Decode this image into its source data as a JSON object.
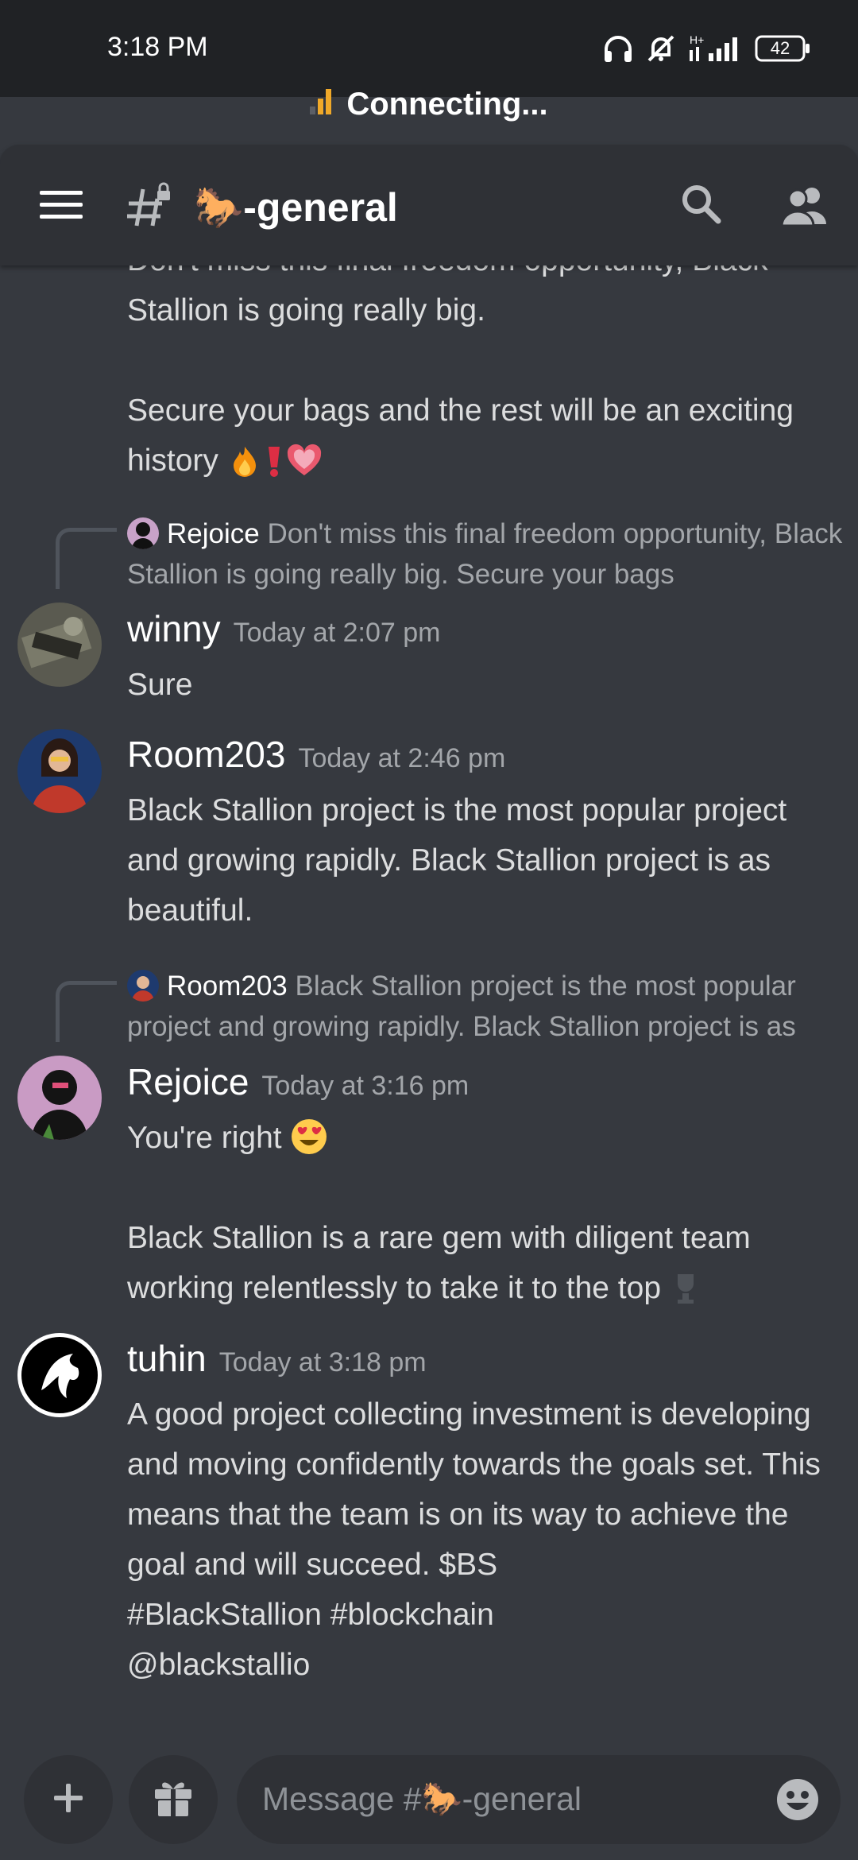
{
  "status_bar": {
    "time": "3:18 PM",
    "network": "H+",
    "battery": "42",
    "connection_status": "Connecting..."
  },
  "header": {
    "channel_name": "🐎-general"
  },
  "messages": {
    "partial_text_line1": "Don't miss this final freedom opportunity, Black",
    "partial_text_line2": "Stallion is going really big.",
    "partial_text_line3": "Secure your bags and the rest will be an exciting",
    "partial_text_line4": "history",
    "reply1": {
      "author": "Rejoice",
      "excerpt": "Don't miss this final freedom opportunity, Black Stallion is going really big.    Secure your bags"
    },
    "winny": {
      "username": "winny",
      "timestamp": "Today at 2:07 pm",
      "text": "Sure"
    },
    "room203": {
      "username": "Room203",
      "timestamp": "Today at 2:46 pm",
      "text": "Black Stallion project is the most popular project and growing rapidly. Black Stallion project is as beautiful."
    },
    "reply2": {
      "author": "Room203",
      "excerpt": "Black Stallion project is the most popular project and growing rapidly. Black Stallion project is as"
    },
    "rejoice": {
      "username": "Rejoice",
      "timestamp": "Today at 3:16 pm",
      "text1": "You're right",
      "text2": "Black Stallion is a rare gem with diligent team working relentlessly to take it to the top"
    },
    "tuhin": {
      "username": "tuhin",
      "timestamp": "Today at 3:18 pm",
      "text": "A good project collecting investment is developing and moving confidently towards the goals set. This means that the team is on its way to achieve the goal and will succeed. $BS",
      "hashtags": "#BlackStallion #blockchain",
      "mention": "@blackstallio"
    }
  },
  "composer": {
    "placeholder": "Message #🐎-general"
  },
  "colors": {
    "background": "#36393f",
    "header": "#2f3136",
    "statusbar": "#202225",
    "muted_text": "#a3a6aa",
    "accent_bar": "#f0a929"
  },
  "icons": [
    "headphones-icon",
    "bell-off-icon",
    "signal-icon",
    "battery-icon",
    "menu-icon",
    "locked-hash-icon",
    "search-icon",
    "members-icon",
    "plus-icon",
    "gift-icon",
    "emoji-icon"
  ]
}
